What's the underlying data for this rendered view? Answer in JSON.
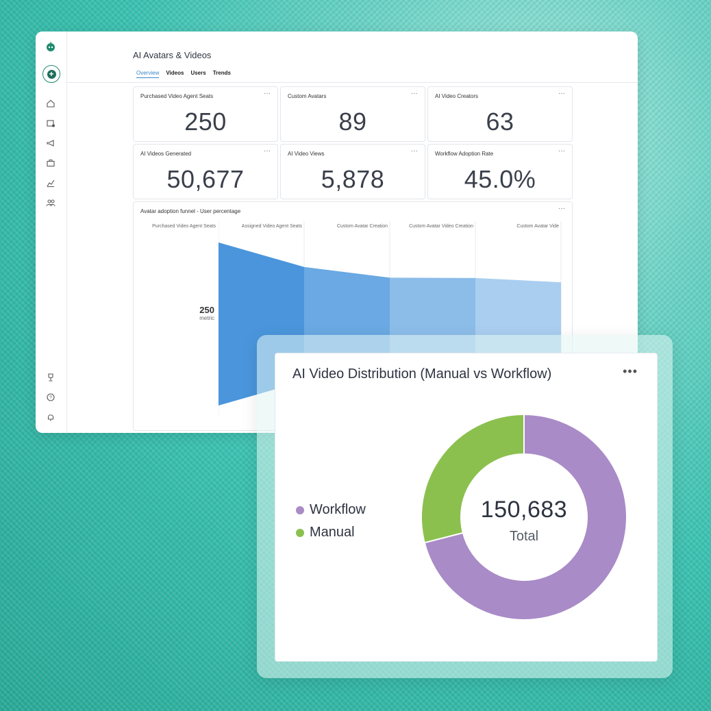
{
  "app": {
    "page_title": "AI Avatars & Videos",
    "tabs": [
      {
        "label": "Overview",
        "active": true
      },
      {
        "label": "Videos",
        "active": false
      },
      {
        "label": "Users",
        "active": false
      },
      {
        "label": "Trends",
        "active": false
      }
    ],
    "rail_icons": [
      "home-icon",
      "calendar-icon",
      "megaphone-icon",
      "briefcase-icon",
      "analytics-icon",
      "users-icon",
      "trophy-icon",
      "help-icon",
      "bell-icon"
    ]
  },
  "kpis": [
    {
      "title": "Purchased Video Agent Seats",
      "value": "250"
    },
    {
      "title": "Custom Avatars",
      "value": "89"
    },
    {
      "title": "AI Video Creators",
      "value": "63"
    },
    {
      "title": "AI Videos Generated",
      "value": "50,677"
    },
    {
      "title": "AI Video Views",
      "value": "5,878"
    },
    {
      "title": "Workflow Adoption Rate",
      "value": "45.0%"
    }
  ],
  "menu_glyph": "···",
  "funnel": {
    "title": "Avatar adoption funnel - User percentage",
    "stages": [
      "Purchased Video Agent Seats",
      "Assigned Video Agent Seats",
      "Custom Avatar Creation",
      "Custom Avatar Video Creation",
      "Custom Avatar Vide"
    ],
    "metric_value": "250",
    "metric_unit": "metric",
    "colors": [
      "#4a95dc",
      "#6aa9e3",
      "#8cbde9",
      "#a9ceef"
    ]
  },
  "distribution": {
    "title": "AI Video Distribution (Manual vs Workflow)",
    "menu": "•••",
    "center_value": "150,683",
    "center_label": "Total",
    "legend": [
      {
        "label": "Workflow",
        "color": "#a98bc7"
      },
      {
        "label": "Manual",
        "color": "#8bc04e"
      }
    ]
  },
  "chart_data": [
    {
      "type": "area",
      "title": "Avatar adoption funnel - User percentage",
      "categories": [
        "Purchased Video Agent Seats",
        "Assigned Video Agent Seats",
        "Custom Avatar Creation",
        "Custom Avatar Video Creation",
        "Custom Avatar Vide"
      ],
      "values": [
        250,
        175,
        142,
        141,
        128
      ]
    },
    {
      "type": "pie",
      "title": "AI Video Distribution (Manual vs Workflow)",
      "categories": [
        "Workflow",
        "Manual"
      ],
      "values": [
        71,
        29
      ],
      "total": "150,683"
    }
  ]
}
